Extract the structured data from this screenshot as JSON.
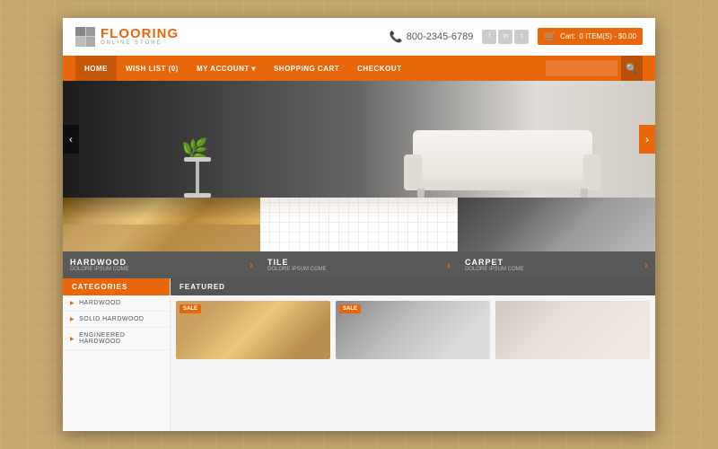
{
  "header": {
    "logo_first": "FLOOR",
    "logo_accent": "ING",
    "logo_sub": "ONLINE STORE",
    "phone": "800-2345-6789",
    "cart_label": "Cart:",
    "cart_items": "0 ITEM(S) - $0.00",
    "social": [
      "f",
      "in",
      "tw"
    ]
  },
  "nav": {
    "items": [
      {
        "label": "HOME"
      },
      {
        "label": "WISH LIST (0)"
      },
      {
        "label": "MY ACCOUNT ▾"
      },
      {
        "label": "SHOPPING CART"
      },
      {
        "label": "CHECKOUT"
      }
    ]
  },
  "categories": [
    {
      "id": "hardwood",
      "title": "HARDWOOD",
      "sub": "DOLORE IPSUM COME"
    },
    {
      "id": "tile",
      "title": "TILE",
      "sub": "DOLORE IPSUM COME"
    },
    {
      "id": "carpet",
      "title": "CARPET",
      "sub": "DOLORE IPSUM COME"
    }
  ],
  "sidebar": {
    "header": "CATEGORIES",
    "items": [
      {
        "label": "HARDWOOD"
      },
      {
        "label": "SOLID HARDWOOD"
      },
      {
        "label": "ENGINEERED HARDWOOD"
      }
    ]
  },
  "featured": {
    "header": "FEATURED",
    "items": [
      {
        "sale": true
      },
      {
        "sale": true
      },
      {
        "sale": false
      }
    ]
  },
  "hero": {
    "arrow_left": "‹",
    "arrow_right": "›"
  }
}
